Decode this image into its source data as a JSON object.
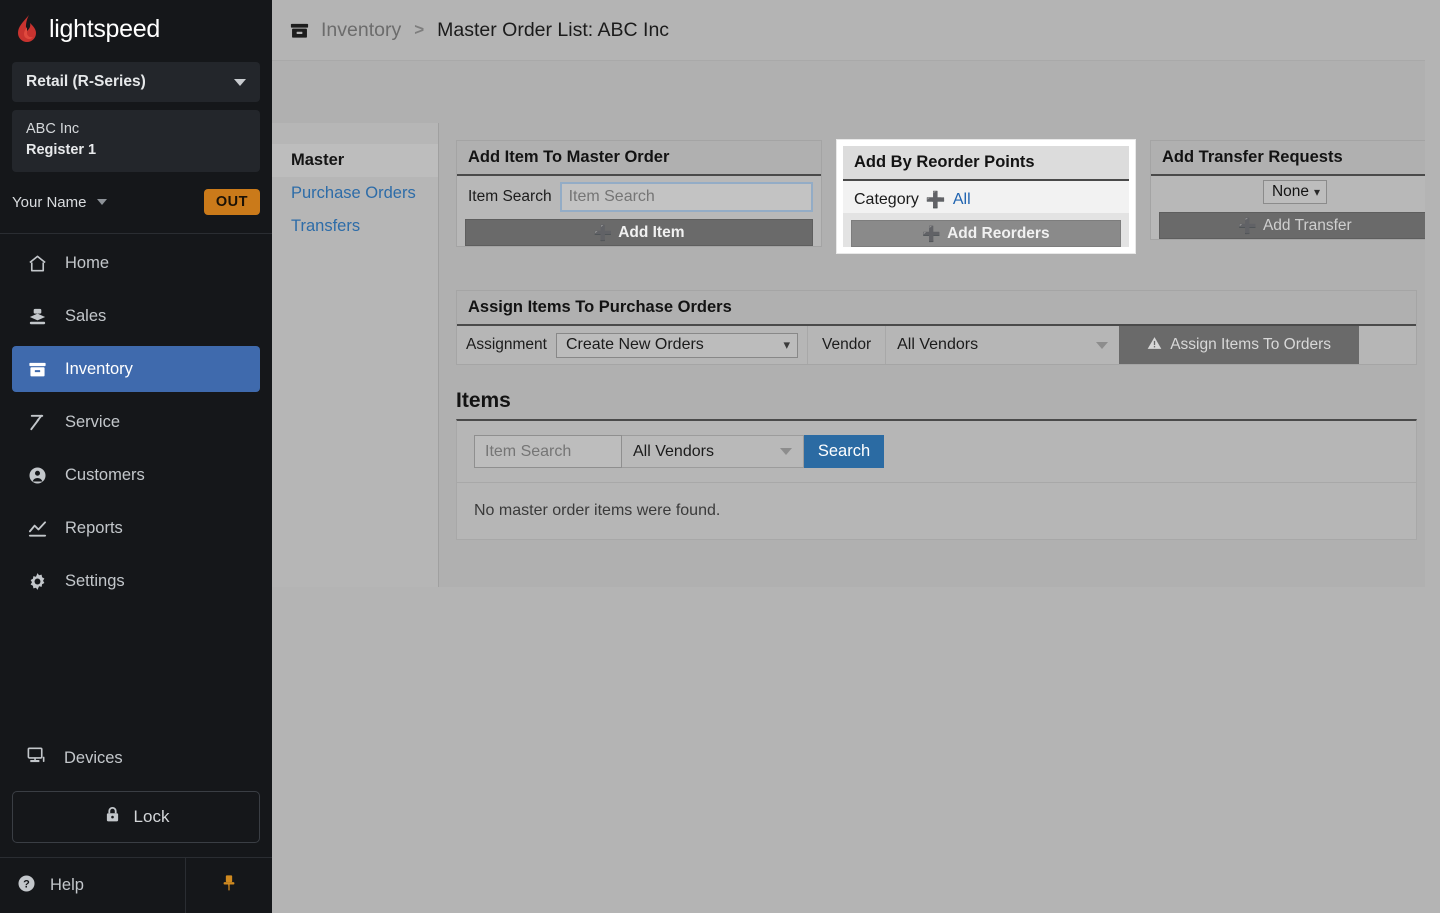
{
  "brand": {
    "name": "lightspeed"
  },
  "sidebar": {
    "product_select": {
      "value": "Retail (R-Series)"
    },
    "store": {
      "company": "ABC Inc",
      "register": "Register 1"
    },
    "user": {
      "name": "Your Name",
      "status_badge": "OUT"
    },
    "nav_items": [
      {
        "label": "Home",
        "icon": "home-icon",
        "active": false
      },
      {
        "label": "Sales",
        "icon": "sales-icon",
        "active": false
      },
      {
        "label": "Inventory",
        "icon": "inventory-icon",
        "active": true
      },
      {
        "label": "Service",
        "icon": "hammer-icon",
        "active": false
      },
      {
        "label": "Customers",
        "icon": "user-circle-icon",
        "active": false
      },
      {
        "label": "Reports",
        "icon": "chart-line-icon",
        "active": false
      },
      {
        "label": "Settings",
        "icon": "gear-icon",
        "active": false
      }
    ],
    "devices": {
      "label": "Devices",
      "icon": "monitor-icon"
    },
    "lock": {
      "label": "Lock",
      "icon": "lock-icon"
    },
    "help": {
      "label": "Help",
      "icon": "question-circle-icon"
    },
    "pin": {
      "icon": "pin-icon",
      "color": "#d08a20"
    }
  },
  "breadcrumb": {
    "icon": "inventory-box-icon",
    "parent": "Inventory",
    "separator": ">",
    "current": "Master Order List: ABC Inc"
  },
  "subnav": {
    "items": [
      {
        "label": "Master",
        "active": true
      },
      {
        "label": "Purchase Orders",
        "active": false
      },
      {
        "label": "Transfers",
        "active": false
      }
    ]
  },
  "cards": {
    "add_item": {
      "title": "Add Item To Master Order",
      "field_label": "Item Search",
      "field_value": "",
      "field_placeholder": "Item Search",
      "button_label": "Add Item",
      "button_icon": "plus-icon"
    },
    "add_reorder": {
      "title": "Add By Reorder Points",
      "category_label": "Category",
      "category_link": "All",
      "category_icon": "plus-icon",
      "button_label": "Add Reorders",
      "button_icon": "plus-icon",
      "highlighted": true
    },
    "add_transfer": {
      "title": "Add Transfer Requests",
      "select_value": "None",
      "button_label": "Add Transfer",
      "button_icon": "plus-icon"
    }
  },
  "assign": {
    "title": "Assign Items To Purchase Orders",
    "assignment_label": "Assignment",
    "assignment_value": "Create New Orders",
    "vendor_label": "Vendor",
    "vendor_value": "All Vendors",
    "button_label": "Assign Items To Orders",
    "button_icon": "warning-triangle-icon"
  },
  "items": {
    "title": "Items",
    "search_value": "",
    "search_placeholder": "Item Search",
    "vendor_value": "All Vendors",
    "search_button": "Search",
    "empty_message": "No master order items were found."
  },
  "colors": {
    "accent_blue": "#3f6aad",
    "link_blue": "#1f63b0",
    "search_blue": "#2b6ba3",
    "badge_orange": "#ca7a1a",
    "sidebar_bg": "#15171a",
    "page_bg": "#b4b4b4"
  }
}
